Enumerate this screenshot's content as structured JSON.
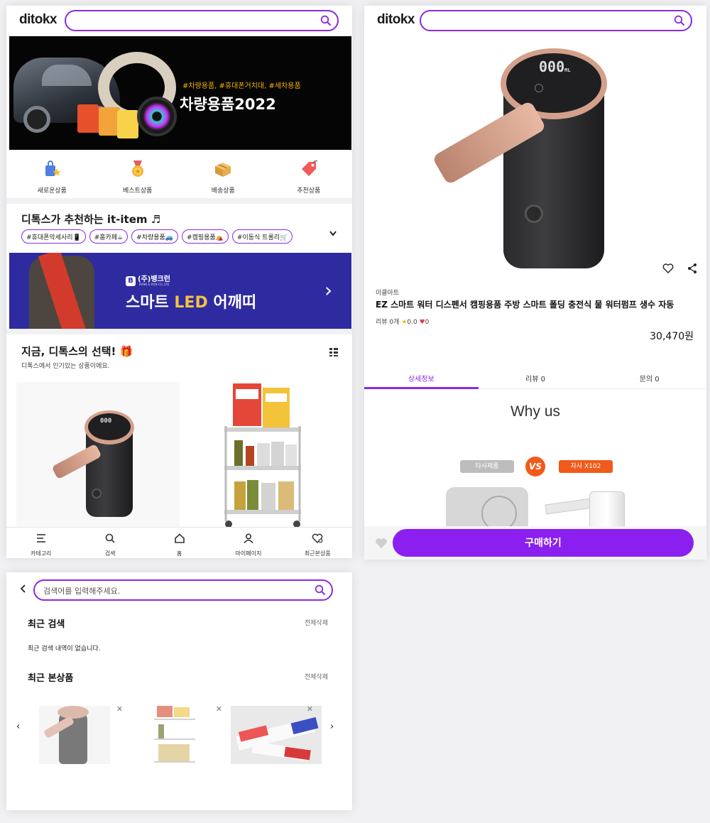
{
  "app": {
    "logo": "ditokx"
  },
  "home": {
    "banner1": {
      "tags": "#차량용품, #휴대폰거치대, #세차용품",
      "title": "차량용품2022"
    },
    "categories": [
      {
        "label": "새로운상품",
        "icon": "shopping-bag-star-icon"
      },
      {
        "label": "베스트상품",
        "icon": "medal-icon"
      },
      {
        "label": "배송상품",
        "icon": "box-icon"
      },
      {
        "label": "추천상품",
        "icon": "tag-icon"
      }
    ],
    "it_item": {
      "title": "디톡스가 추천하는 it-item ♬",
      "hashtags": [
        "#휴대폰악세사리📱",
        "#홈카페☕",
        "#차량용품🚙",
        "#캠핑용품⛺",
        "#이동식 트롤리🛒"
      ],
      "more_icon": "chevron-down-icon"
    },
    "banner2": {
      "brand": "(주)뱅크런",
      "brand_sub": "BANK & RUN CO.,LTD.",
      "headline_pre": "스마트 ",
      "headline_led": "LED",
      "headline_post": " 어깨띠",
      "arrow": "›"
    },
    "choice": {
      "title": "지금, 디톡스의 선택! 🎁",
      "subtitle": "디톡스에서 인기있는 상품이에요."
    },
    "tabbar": [
      {
        "label": "카테고리",
        "icon": "menu-icon"
      },
      {
        "label": "검색",
        "icon": "search-icon"
      },
      {
        "label": "홈",
        "icon": "home-icon"
      },
      {
        "label": "마이페이지",
        "icon": "user-icon"
      },
      {
        "label": "최근본상품",
        "icon": "heart-clock-icon"
      }
    ],
    "dispenser_display": "000"
  },
  "product": {
    "display": "000",
    "display_unit": "ML",
    "seller": "이클아트",
    "name": "EZ 스마트 워터 디스펜서 캠핑용품 주방 스마트 폴딩 충전식 물 워터펌프 생수 자동",
    "review_label": "리뷰 0개",
    "rating": "0.0",
    "likes": "0",
    "price": "30,470원",
    "tabs": [
      {
        "label": "상세정보",
        "active": true
      },
      {
        "label": "리뷰 0",
        "active": false
      },
      {
        "label": "문의 0",
        "active": false
      }
    ],
    "why_us": "Why us",
    "compare": {
      "other": "타사제품",
      "vs": "VS",
      "ours": "자사 X102"
    },
    "buy_label": "구매하기"
  },
  "search": {
    "placeholder": "검색어를 입력해주세요.",
    "recent_search_title": "최근 검색",
    "recent_search_delete": "전체삭제",
    "recent_search_empty": "최근 검색 내역이 없습니다.",
    "recent_products_title": "최근 본상품",
    "recent_products_delete": "전체삭제",
    "prev": "‹",
    "next": "›",
    "remove": "✕"
  }
}
